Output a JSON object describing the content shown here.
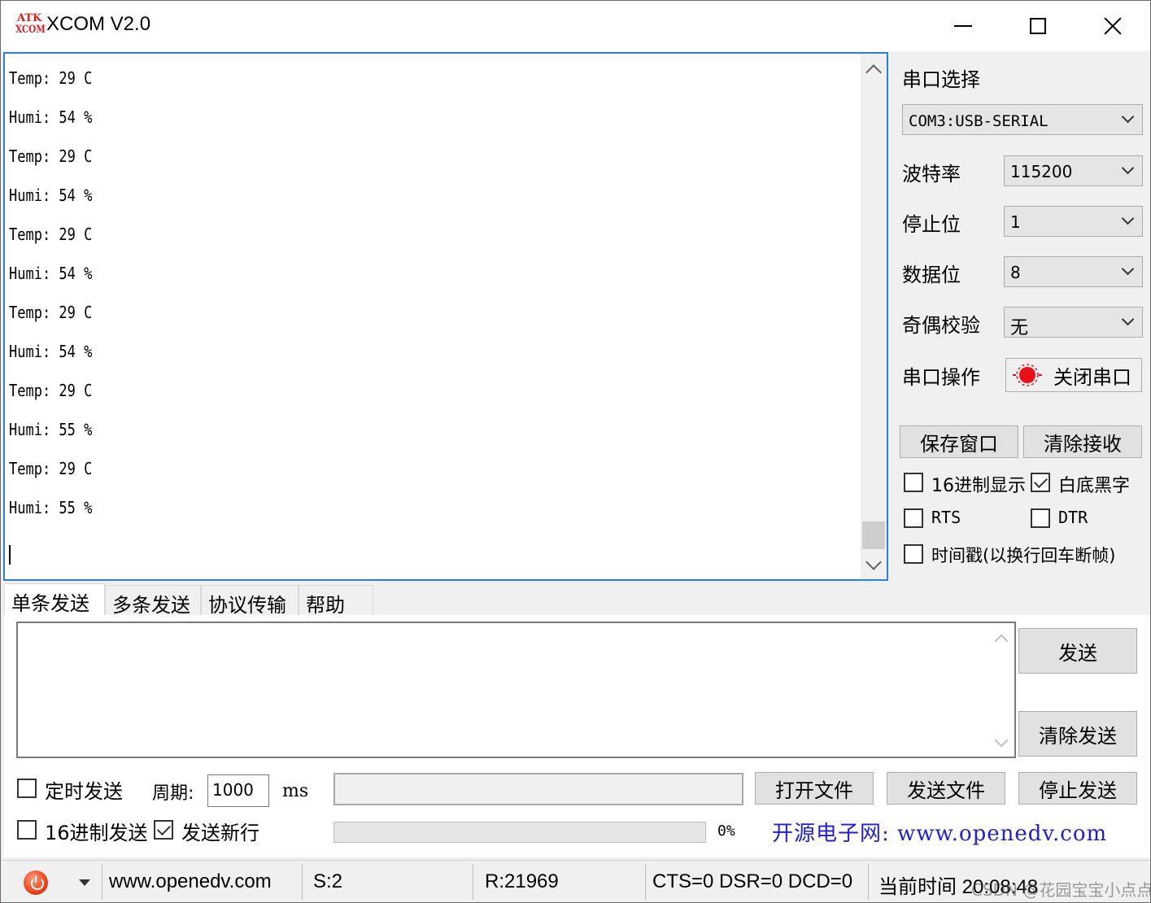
{
  "app": {
    "logo_top": "ATK",
    "logo_bottom": "XCOM",
    "title": "XCOM V2.0"
  },
  "receive": {
    "lines": [
      "Temp: 29 C",
      "Humi: 54 %",
      "Temp: 29 C",
      "Humi: 54 %",
      "Temp: 29 C",
      "Humi: 54 %",
      "Temp: 29 C",
      "Humi: 54 %",
      "Temp: 29 C",
      "Humi: 55 %",
      "Temp: 29 C",
      "Humi: 55 %"
    ]
  },
  "settings": {
    "port_select_label": "串口选择",
    "port_value": "COM3:USB-SERIAL",
    "baud_label": "波特率",
    "baud_value": "115200",
    "stopbits_label": "停止位",
    "stopbits_value": "1",
    "databits_label": "数据位",
    "databits_value": "8",
    "parity_label": "奇偶校验",
    "parity_value": "无",
    "port_op_label": "串口操作",
    "close_port_button": "关闭串口",
    "save_window_button": "保存窗口",
    "clear_receive_button": "清除接收",
    "hex_display_label": "16进制显示",
    "hex_display_checked": false,
    "white_black_label": "白底黑字",
    "white_black_checked": true,
    "rts_label": "RTS",
    "rts_checked": false,
    "dtr_label": "DTR",
    "dtr_checked": false,
    "timestamp_label": "时间戳(以换行回车断帧)",
    "timestamp_checked": false
  },
  "tabs": [
    "单条发送",
    "多条发送",
    "协议传输",
    "帮助"
  ],
  "send": {
    "send_button": "发送",
    "clear_send_button": "清除发送",
    "timed_send_label": "定时发送",
    "timed_send_checked": false,
    "period_label": "周期:",
    "period_value": "1000",
    "period_unit": "ms",
    "open_file_button": "打开文件",
    "send_file_button": "发送文件",
    "stop_send_button": "停止发送",
    "hex_send_label": "16进制发送",
    "hex_send_checked": false,
    "send_newline_label": "发送新行",
    "send_newline_checked": true,
    "progress_text": "0%",
    "progress_value": 0,
    "ad_text": "开源电子网: www.openedv.com"
  },
  "status": {
    "website": "www.openedv.com",
    "sent": "S:2",
    "received": "R:21969",
    "lines_state": "CTS=0 DSR=0 DCD=0",
    "current_time": "当前时间 20:08:48",
    "watermark": "CSDN @花园宝宝小点点"
  }
}
